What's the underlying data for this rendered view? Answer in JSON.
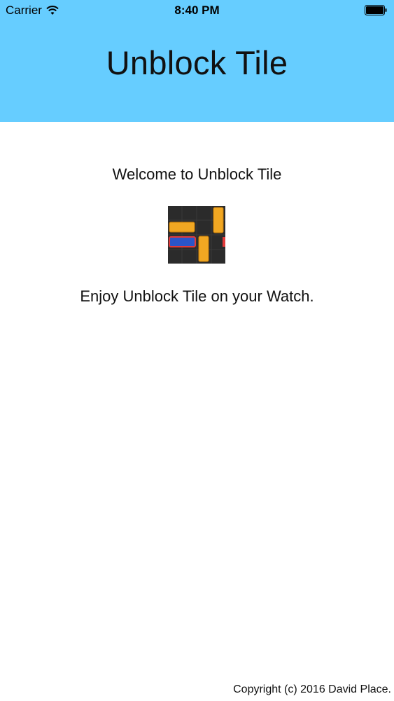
{
  "status_bar": {
    "carrier": "Carrier",
    "time": "8:40 PM",
    "wifi_icon": "wifi-icon",
    "battery_icon": "battery-icon"
  },
  "header": {
    "title": "Unblock Tile",
    "background_color": "#66cdff"
  },
  "main": {
    "welcome_text": "Welcome to Unblock Tile",
    "app_icon": "unblock-tile-app-icon",
    "enjoy_text": "Enjoy Unblock Tile on your Watch."
  },
  "footer": {
    "copyright": "Copyright (c) 2016 David Place."
  }
}
